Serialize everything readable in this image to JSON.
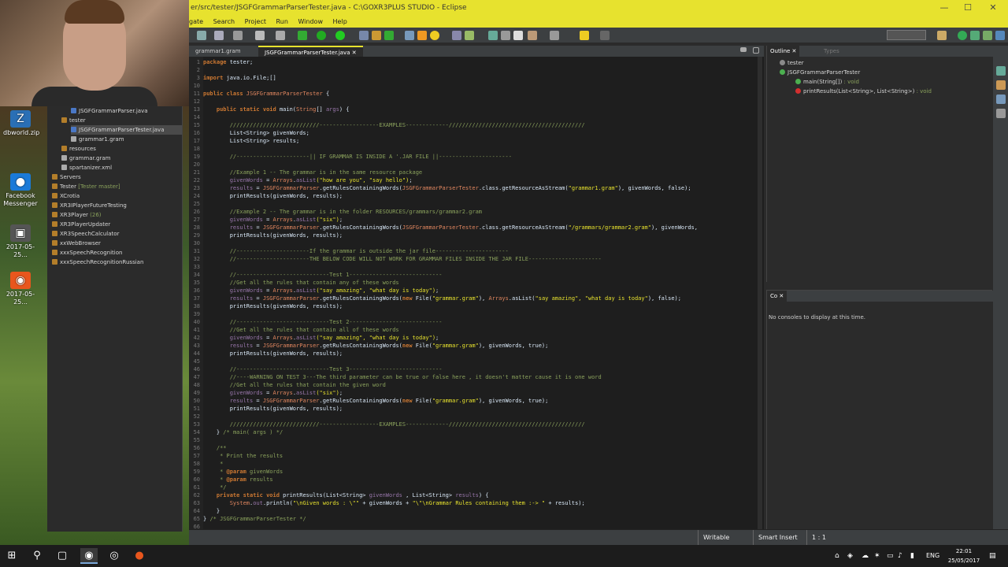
{
  "window": {
    "title": "er/src/tester/JSGFGrammarParserTester.java - C:\\GOXR3PLUS STUDIO - Eclipse",
    "controls": [
      "—",
      "☐",
      "✕"
    ]
  },
  "menu": [
    "gate",
    "Search",
    "Project",
    "Run",
    "Window",
    "Help"
  ],
  "desktop_icons": [
    {
      "label": "dbworld.zip",
      "glyph": "Z",
      "color": "#2a6fb5"
    },
    {
      "label": "Facebook Messenger",
      "glyph": "●",
      "color": "#1a7ad8"
    },
    {
      "label": "2017-05-25...",
      "glyph": "▣",
      "color": "#555555"
    },
    {
      "label": "2017-05-25...",
      "glyph": "◉",
      "color": "#e8561d"
    }
  ],
  "explorer": {
    "items": [
      {
        "label": "JSGFGrammarParser.java",
        "indent": 2,
        "color": "#4a78c6",
        "selected": false,
        "tag": ""
      },
      {
        "label": "tester",
        "indent": 1,
        "color": "#b37e2a",
        "selected": false,
        "tag": ""
      },
      {
        "label": "JSGFGrammarParserTester.java",
        "indent": 2,
        "color": "#4a78c6",
        "selected": true,
        "tag": ""
      },
      {
        "label": "grammar1.gram",
        "indent": 2,
        "color": "#aaaaaa",
        "selected": false,
        "tag": ""
      },
      {
        "label": "resources",
        "indent": 1,
        "color": "#b37e2a",
        "selected": false,
        "tag": ""
      },
      {
        "label": "grammar.gram",
        "indent": 1,
        "color": "#aaaaaa",
        "selected": false,
        "tag": ""
      },
      {
        "label": "spartanizer.xml",
        "indent": 1,
        "color": "#aaaaaa",
        "selected": false,
        "tag": ""
      },
      {
        "label": "Servers",
        "indent": 0,
        "color": "#b37e2a",
        "selected": false,
        "tag": ""
      },
      {
        "label": "Tester",
        "indent": 0,
        "color": "#b37e2a",
        "selected": false,
        "tag": "[Tester master]"
      },
      {
        "label": "XCrotia",
        "indent": 0,
        "color": "#b37e2a",
        "selected": false,
        "tag": ""
      },
      {
        "label": "XR3IPlayerFutureTesting",
        "indent": 0,
        "color": "#b37e2a",
        "selected": false,
        "tag": ""
      },
      {
        "label": "XR3Player",
        "indent": 0,
        "color": "#b37e2a",
        "selected": false,
        "tag": "(26)"
      },
      {
        "label": "XR3PlayerUpdater",
        "indent": 0,
        "color": "#b37e2a",
        "selected": false,
        "tag": ""
      },
      {
        "label": "XR3SpeechCalculator",
        "indent": 0,
        "color": "#b37e2a",
        "selected": false,
        "tag": ""
      },
      {
        "label": "xxWebBrowser",
        "indent": 0,
        "color": "#b37e2a",
        "selected": false,
        "tag": ""
      },
      {
        "label": "xxxSpeechRecognition",
        "indent": 0,
        "color": "#b37e2a",
        "selected": false,
        "tag": ""
      },
      {
        "label": "xxxSpeechRecognitionRussian",
        "indent": 0,
        "color": "#b37e2a",
        "selected": false,
        "tag": ""
      }
    ]
  },
  "editor": {
    "tabs": [
      {
        "label": "grammar1.gram",
        "active": false
      },
      {
        "label": "JSGFGrammarParserTester.java ✕",
        "active": true
      }
    ],
    "lines": [
      {
        "n": "1",
        "segs": [
          [
            "kw",
            "package"
          ],
          [
            "code",
            " tester;"
          ]
        ]
      },
      {
        "n": "2",
        "segs": []
      },
      {
        "n": "3",
        "segs": [
          [
            "kw",
            "import"
          ],
          [
            "code",
            " java.io.File;[]"
          ]
        ]
      },
      {
        "n": "10",
        "segs": []
      },
      {
        "n": "11",
        "segs": [
          [
            "kw",
            "public class "
          ],
          [
            "cls",
            "JSGFGrammarParserTester"
          ],
          [
            "code",
            " {"
          ]
        ]
      },
      {
        "n": "12",
        "segs": []
      },
      {
        "n": "13",
        "segs": [
          [
            "kw",
            "    public static void "
          ],
          [
            "code",
            "main("
          ],
          [
            "cls",
            "String"
          ],
          [
            "code",
            "[] "
          ],
          [
            "fld",
            "args"
          ],
          [
            "code",
            ") {"
          ]
        ]
      },
      {
        "n": "14",
        "segs": []
      },
      {
        "n": "15",
        "segs": [
          [
            "cm",
            "        ///////////////////////////------------------EXAMPLES-------------/////////////////////////////////////////"
          ]
        ]
      },
      {
        "n": "16",
        "segs": [
          [
            "code",
            "        List<String> givenWords;"
          ]
        ]
      },
      {
        "n": "17",
        "segs": [
          [
            "code",
            "        List<String> results;"
          ]
        ]
      },
      {
        "n": "18",
        "segs": []
      },
      {
        "n": "19",
        "segs": [
          [
            "cm",
            "        //----------------------|| IF GRAMMAR IS INSIDE A '.JAR FILE ||----------------------"
          ]
        ]
      },
      {
        "n": "20",
        "segs": []
      },
      {
        "n": "21",
        "segs": [
          [
            "cm",
            "        //Example 1 -- The grammar is in the same resource package"
          ]
        ]
      },
      {
        "n": "22",
        "segs": [
          [
            "fld",
            "        givenWords"
          ],
          [
            "code",
            " = "
          ],
          [
            "cls",
            "Arrays"
          ],
          [
            "code",
            "."
          ],
          [
            "fld",
            "asList"
          ],
          [
            "st",
            "(\"how are you\", \"say hello\")"
          ],
          [
            "code",
            ";"
          ]
        ]
      },
      {
        "n": "23",
        "segs": [
          [
            "fld",
            "        results"
          ],
          [
            "code",
            " = "
          ],
          [
            "cls",
            "JSGFGrammarParser"
          ],
          [
            "code",
            ".getRulesContainingWords("
          ],
          [
            "cls",
            "JSGFGrammarParserTester"
          ],
          [
            "code",
            ".class.getResourceAsStream("
          ],
          [
            "st",
            "\"grammar1.gram\""
          ],
          [
            "code",
            "), givenWords, false);"
          ]
        ]
      },
      {
        "n": "24",
        "segs": [
          [
            "code",
            "        printResults(givenWords, results);"
          ]
        ]
      },
      {
        "n": "25",
        "segs": []
      },
      {
        "n": "26",
        "segs": [
          [
            "cm",
            "        //Example 2 -- The grammar is in the folder RESOURCES/grammars/grammar2.gram"
          ]
        ]
      },
      {
        "n": "27",
        "segs": [
          [
            "fld",
            "        givenWords"
          ],
          [
            "code",
            " = "
          ],
          [
            "cls",
            "Arrays"
          ],
          [
            "code",
            "."
          ],
          [
            "fld",
            "asList"
          ],
          [
            "st",
            "(\"six\")"
          ],
          [
            "code",
            ";"
          ]
        ]
      },
      {
        "n": "28",
        "segs": [
          [
            "fld",
            "        results"
          ],
          [
            "code",
            " = "
          ],
          [
            "cls",
            "JSGFGrammarParser"
          ],
          [
            "code",
            ".getRulesContainingWords("
          ],
          [
            "cls",
            "JSGFGrammarParserTester"
          ],
          [
            "code",
            ".class.getResourceAsStream("
          ],
          [
            "st",
            "\"/grammars/grammar2.gram\""
          ],
          [
            "code",
            "), givenWords,"
          ]
        ]
      },
      {
        "n": "29",
        "segs": [
          [
            "code",
            "        printResults(givenWords, results);"
          ]
        ]
      },
      {
        "n": "30",
        "segs": []
      },
      {
        "n": "31",
        "segs": [
          [
            "cm",
            "        //----------------------If the grammar is outside the jar file----------------------"
          ]
        ]
      },
      {
        "n": "32",
        "segs": [
          [
            "cm",
            "        //----------------------THE BELOW CODE WILL NOT WORK FOR GRAMMAR FILES INSIDE THE JAR FILE----------------------"
          ]
        ]
      },
      {
        "n": "33",
        "segs": []
      },
      {
        "n": "34",
        "segs": [
          [
            "cm",
            "        //----------------------------Test 1----------------------------"
          ]
        ]
      },
      {
        "n": "35",
        "segs": [
          [
            "cm",
            "        //Get all the rules that contain any of these words"
          ]
        ]
      },
      {
        "n": "36",
        "segs": [
          [
            "fld",
            "        givenWords"
          ],
          [
            "code",
            " = "
          ],
          [
            "cls",
            "Arrays"
          ],
          [
            "code",
            "."
          ],
          [
            "fld",
            "asList"
          ],
          [
            "st",
            "(\"say amazing\", \"what day is today\")"
          ],
          [
            "code",
            ";"
          ]
        ]
      },
      {
        "n": "37",
        "segs": [
          [
            "fld",
            "        results"
          ],
          [
            "code",
            " = "
          ],
          [
            "cls",
            "JSGFGrammarParser"
          ],
          [
            "code",
            ".getRulesContainingWords("
          ],
          [
            "kw",
            "new "
          ],
          [
            "code",
            "File("
          ],
          [
            "st",
            "\"grammar.gram\""
          ],
          [
            "code",
            "), "
          ],
          [
            "cls",
            "Arrays"
          ],
          [
            "code",
            ".asList("
          ],
          [
            "st",
            "\"say amazing\", \"what day is today\""
          ],
          [
            "code",
            "), false);"
          ]
        ]
      },
      {
        "n": "38",
        "segs": [
          [
            "code",
            "        printResults(givenWords, results);"
          ]
        ]
      },
      {
        "n": "39",
        "segs": []
      },
      {
        "n": "40",
        "segs": [
          [
            "cm",
            "        //----------------------------Test 2----------------------------"
          ]
        ]
      },
      {
        "n": "41",
        "segs": [
          [
            "cm",
            "        //Get all the rules that contain all of these words"
          ]
        ]
      },
      {
        "n": "42",
        "segs": [
          [
            "fld",
            "        givenWords"
          ],
          [
            "code",
            " = "
          ],
          [
            "cls",
            "Arrays"
          ],
          [
            "code",
            "."
          ],
          [
            "fld",
            "asList"
          ],
          [
            "st",
            "(\"say amazing\", \"what day is today\")"
          ],
          [
            "code",
            ";"
          ]
        ]
      },
      {
        "n": "43",
        "segs": [
          [
            "fld",
            "        results"
          ],
          [
            "code",
            " = "
          ],
          [
            "cls",
            "JSGFGrammarParser"
          ],
          [
            "code",
            ".getRulesContainingWords("
          ],
          [
            "kw",
            "new "
          ],
          [
            "code",
            "File("
          ],
          [
            "st",
            "\"grammar.gram\""
          ],
          [
            "code",
            "), givenWords, true);"
          ]
        ]
      },
      {
        "n": "44",
        "segs": [
          [
            "code",
            "        printResults(givenWords, results);"
          ]
        ]
      },
      {
        "n": "45",
        "segs": []
      },
      {
        "n": "46",
        "segs": [
          [
            "cm",
            "        //----------------------------Test 3----------------------------"
          ]
        ]
      },
      {
        "n": "47",
        "segs": [
          [
            "cm",
            "        //----WARNING ON TEST 3---The third parameter can be true or false here , it doesn't matter cause it is one word"
          ]
        ]
      },
      {
        "n": "48",
        "segs": [
          [
            "cm",
            "        //Get all the rules that contain the given word"
          ]
        ]
      },
      {
        "n": "49",
        "segs": [
          [
            "fld",
            "        givenWords"
          ],
          [
            "code",
            " = "
          ],
          [
            "cls",
            "Arrays"
          ],
          [
            "code",
            "."
          ],
          [
            "fld",
            "asList"
          ],
          [
            "st",
            "(\"six\")"
          ],
          [
            "code",
            ";"
          ]
        ]
      },
      {
        "n": "50",
        "segs": [
          [
            "fld",
            "        results"
          ],
          [
            "code",
            " = "
          ],
          [
            "cls",
            "JSGFGrammarParser"
          ],
          [
            "code",
            ".getRulesContainingWords("
          ],
          [
            "kw",
            "new "
          ],
          [
            "code",
            "File("
          ],
          [
            "st",
            "\"grammar.gram\""
          ],
          [
            "code",
            "), givenWords, true);"
          ]
        ]
      },
      {
        "n": "51",
        "segs": [
          [
            "code",
            "        printResults(givenWords, results);"
          ]
        ]
      },
      {
        "n": "52",
        "segs": []
      },
      {
        "n": "53",
        "segs": [
          [
            "cm",
            "        ///////////////////////////------------------EXAMPLES-------------/////////////////////////////////////////"
          ]
        ]
      },
      {
        "n": "54",
        "segs": [
          [
            "code",
            "    } "
          ],
          [
            "cm",
            "/* main( args ) */"
          ]
        ]
      },
      {
        "n": "55",
        "segs": []
      },
      {
        "n": "56",
        "segs": [
          [
            "cm",
            "    /**"
          ]
        ]
      },
      {
        "n": "57",
        "segs": [
          [
            "cm",
            "     * Print the results"
          ]
        ]
      },
      {
        "n": "58",
        "segs": [
          [
            "cm",
            "     *"
          ]
        ]
      },
      {
        "n": "59",
        "segs": [
          [
            "cm",
            "     * "
          ],
          [
            "kw",
            "@param"
          ],
          [
            "cm",
            " givenWords"
          ]
        ]
      },
      {
        "n": "60",
        "segs": [
          [
            "cm",
            "     * "
          ],
          [
            "kw",
            "@param"
          ],
          [
            "cm",
            " results"
          ]
        ]
      },
      {
        "n": "61",
        "segs": [
          [
            "cm",
            "     */"
          ]
        ]
      },
      {
        "n": "62",
        "segs": [
          [
            "kw",
            "    private static void "
          ],
          [
            "code",
            "printResults(List<String> "
          ],
          [
            "fld",
            "givenWords"
          ],
          [
            "code",
            " , List<String> "
          ],
          [
            "fld",
            "results"
          ],
          [
            "code",
            ") {"
          ]
        ]
      },
      {
        "n": "63",
        "segs": [
          [
            "cls",
            "        System"
          ],
          [
            "code",
            "."
          ],
          [
            "fld",
            "out"
          ],
          [
            "code",
            ".println("
          ],
          [
            "st",
            "\"\\nGiven words : \\\"\""
          ],
          [
            "code",
            " + givenWords + "
          ],
          [
            "st",
            "\"\\\"\\nGrammar Rules containing them :-> \""
          ],
          [
            "code",
            " + results);"
          ]
        ]
      },
      {
        "n": "64",
        "segs": [
          [
            "code",
            "    }"
          ]
        ]
      },
      {
        "n": "65",
        "segs": [
          [
            "code",
            "} "
          ],
          [
            "cm",
            "/* JSGFGrammarParserTester */"
          ]
        ]
      },
      {
        "n": "66",
        "segs": []
      }
    ]
  },
  "outline": {
    "tabs": [
      "Outline ✕",
      "Types"
    ],
    "items": [
      {
        "label": "tester",
        "indent": 1,
        "ret": "",
        "color": "#8a8a8a"
      },
      {
        "label": "JSGFGrammarParserTester",
        "indent": 1,
        "ret": "",
        "color": "#4caf50"
      },
      {
        "label": "main(String[])",
        "indent": 3,
        "ret": " : void",
        "color": "#4caf50"
      },
      {
        "label": "printResults(List<String>, List<String>)",
        "indent": 3,
        "ret": " : void",
        "color": "#d32f2f"
      }
    ]
  },
  "console": {
    "tab": "Co ✕",
    "message": "No consoles to display at this time."
  },
  "status": {
    "writable": "Writable",
    "insert_mode": "Smart Insert",
    "position": "1 : 1"
  },
  "taskbar": {
    "time": "22:01",
    "date": "25/05/2017",
    "language": "ENG"
  }
}
